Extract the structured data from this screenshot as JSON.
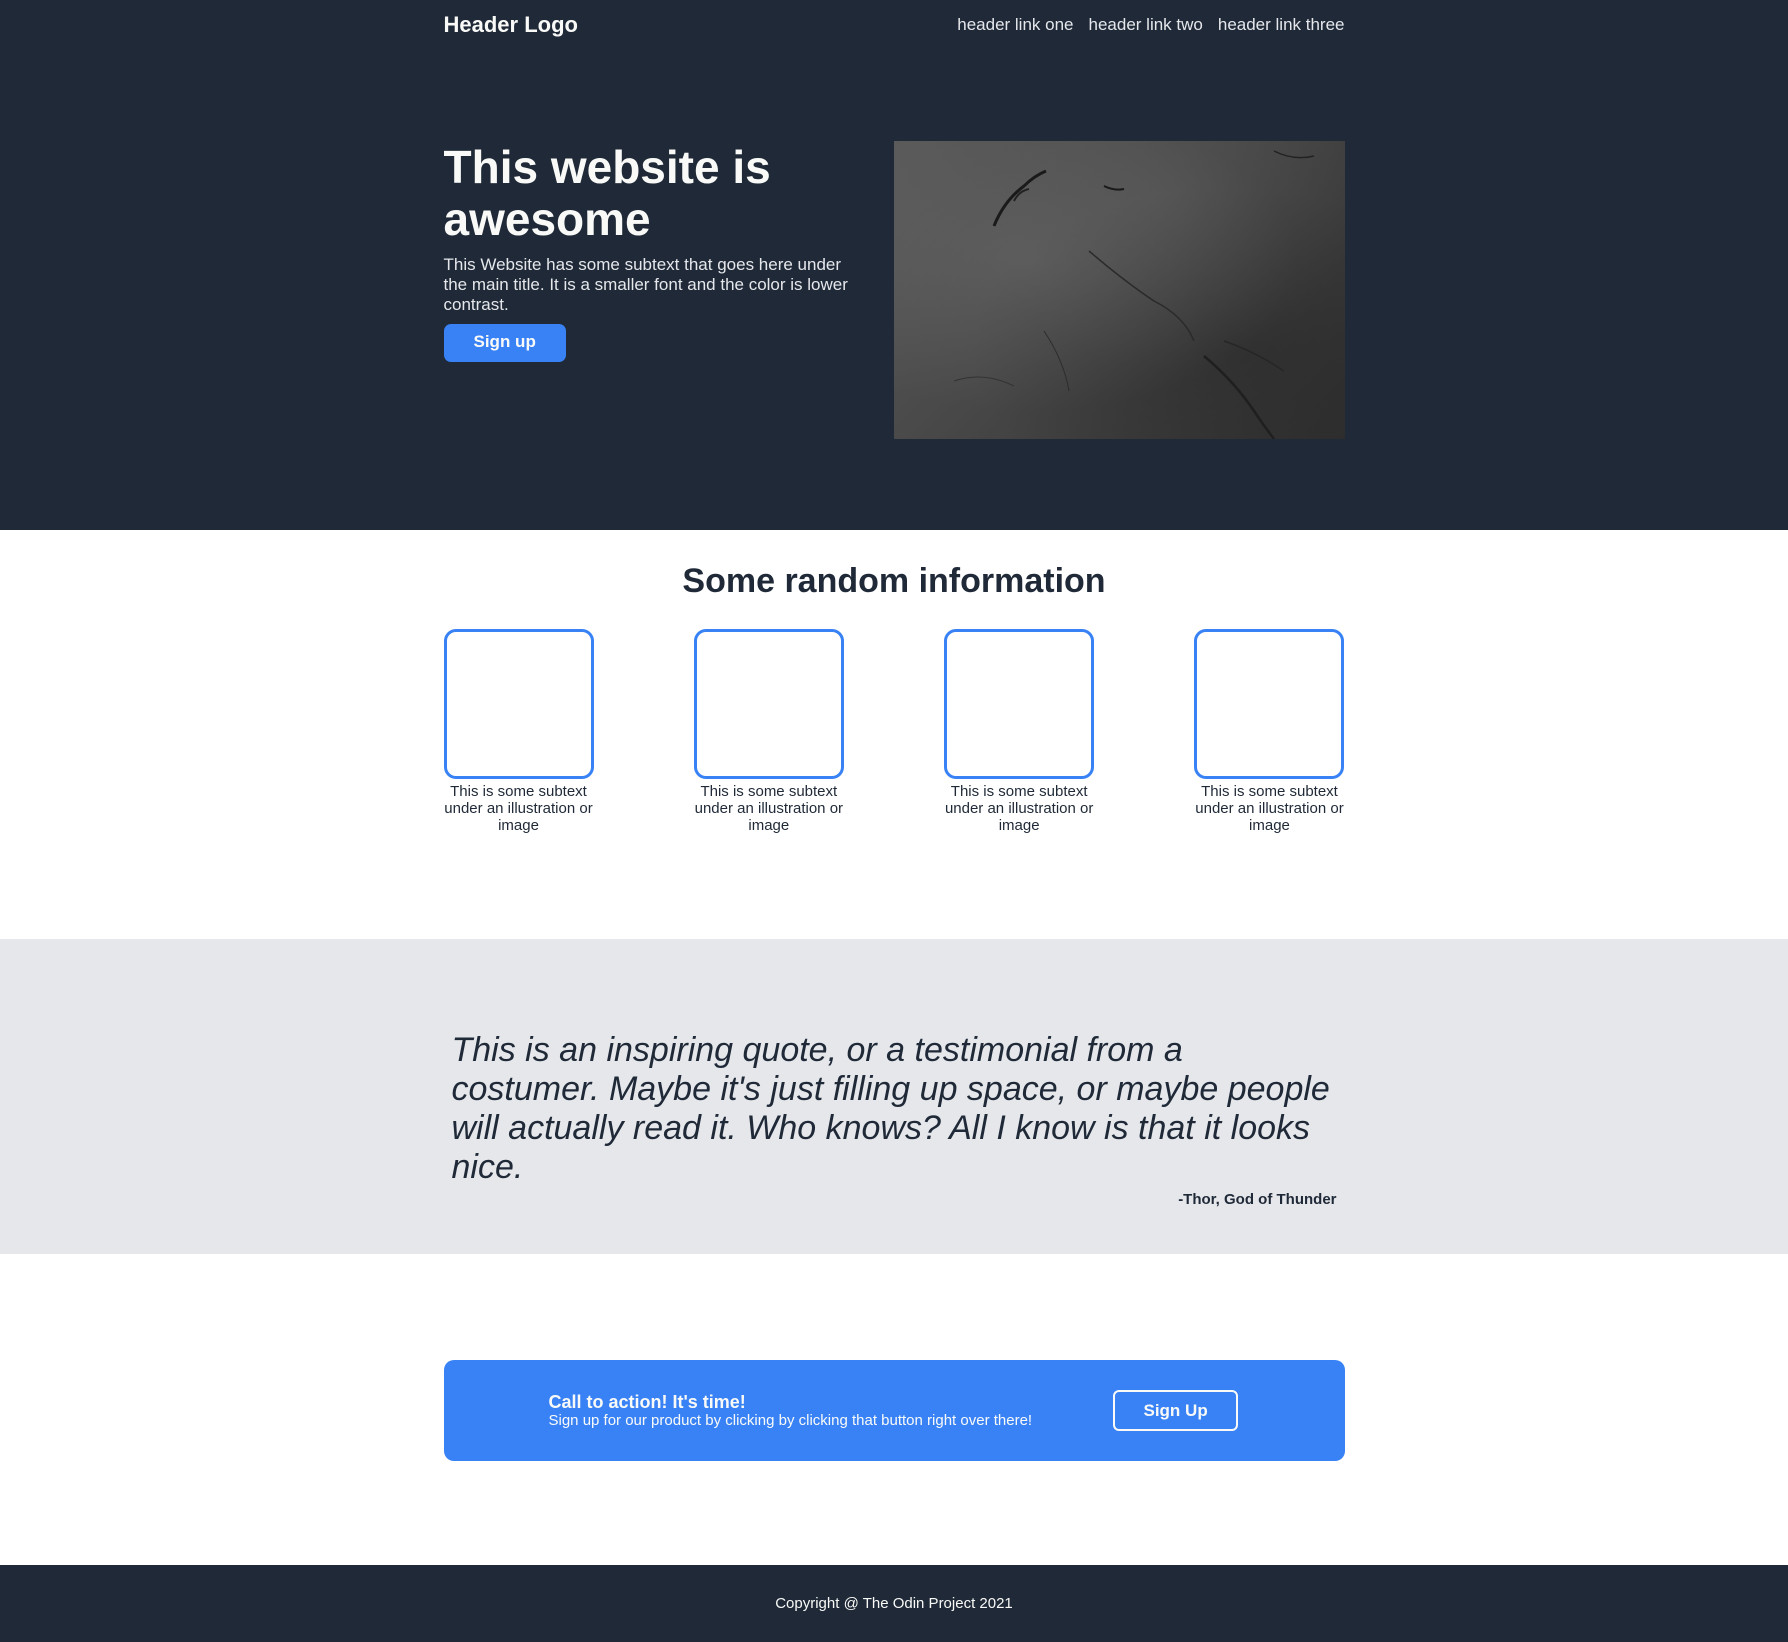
{
  "header": {
    "logo": "Header Logo",
    "links": [
      "header link one",
      "header link two",
      "header link three"
    ]
  },
  "hero": {
    "title": "This website is awesome",
    "subtext": "This Website has some subtext that goes here under the main title. It is a smaller font and the color is lower contrast.",
    "button_label": "Sign up"
  },
  "info": {
    "title": "Some random information",
    "cards": [
      {
        "caption": "This is some subtext under an illustration or image"
      },
      {
        "caption": "This is some subtext under an illustration or image"
      },
      {
        "caption": "This is some subtext under an illustration or image"
      },
      {
        "caption": "This is some subtext under an illustration or image"
      }
    ]
  },
  "quote": {
    "text": "This is an inspiring quote, or a testimonial from a costumer. Maybe it's just filling up space, or maybe people will actually read it. Who knows? All I know is that it looks nice.",
    "author": "-Thor, God of Thunder"
  },
  "cta": {
    "title": "Call to action! It's time!",
    "subtext": "Sign up for our product by clicking by clicking that button right over there!",
    "button_label": "Sign Up"
  },
  "footer": {
    "text": "Copyright @ The Odin Project 2021"
  },
  "colors": {
    "dark": "#1f2937",
    "light_text": "#f9faf8",
    "accent": "#3882f6",
    "quote_bg": "#e5e7eb"
  }
}
